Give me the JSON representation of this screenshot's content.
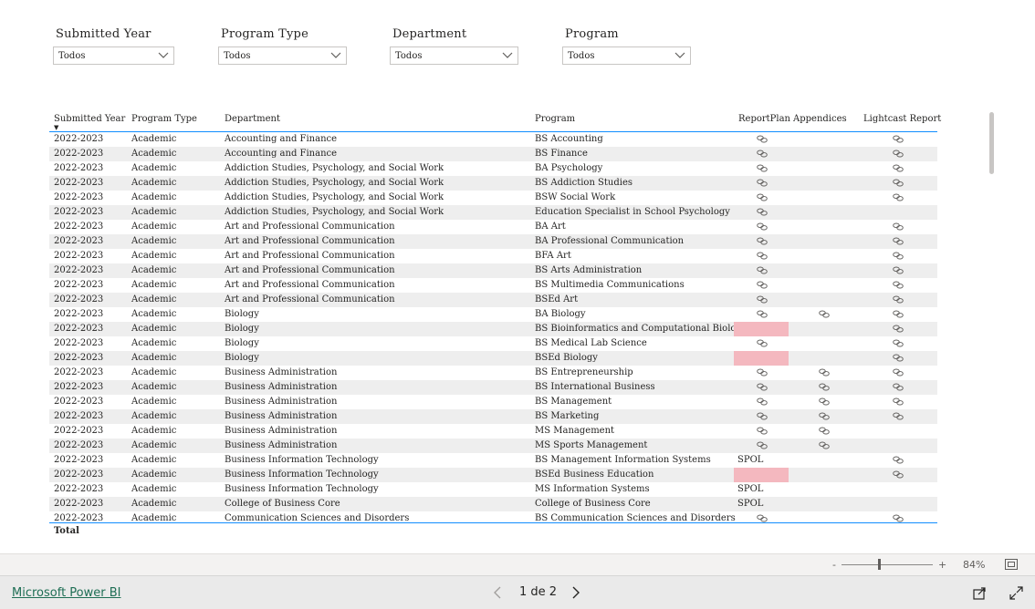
{
  "slicers": [
    {
      "title": "Submitted Year",
      "value": "Todos"
    },
    {
      "title": "Program Type",
      "value": "Todos"
    },
    {
      "title": "Department",
      "value": "Todos"
    },
    {
      "title": "Program",
      "value": "Todos"
    }
  ],
  "table": {
    "columns": [
      "Submitted Year",
      "Program Type",
      "Department",
      "Program",
      "ReportPlan",
      "Appendices",
      "Lightcast Report"
    ],
    "sort_indicator": "▼",
    "rows": [
      {
        "year": "2022-2023",
        "type": "Academic",
        "dept": "Accounting and Finance",
        "program": "BS Accounting",
        "rp": "link",
        "ap": "",
        "lc": "link"
      },
      {
        "year": "2022-2023",
        "type": "Academic",
        "dept": "Accounting and Finance",
        "program": "BS Finance",
        "rp": "link",
        "ap": "",
        "lc": "link"
      },
      {
        "year": "2022-2023",
        "type": "Academic",
        "dept": "Addiction Studies, Psychology, and Social Work",
        "program": "BA Psychology",
        "rp": "link",
        "ap": "",
        "lc": "link"
      },
      {
        "year": "2022-2023",
        "type": "Academic",
        "dept": "Addiction Studies, Psychology, and Social Work",
        "program": "BS Addiction Studies",
        "rp": "link",
        "ap": "",
        "lc": "link"
      },
      {
        "year": "2022-2023",
        "type": "Academic",
        "dept": "Addiction Studies, Psychology, and Social Work",
        "program": "BSW Social Work",
        "rp": "link",
        "ap": "",
        "lc": "link"
      },
      {
        "year": "2022-2023",
        "type": "Academic",
        "dept": "Addiction Studies, Psychology, and Social Work",
        "program": "Education Specialist in School Psychology",
        "rp": "link",
        "ap": "",
        "lc": ""
      },
      {
        "year": "2022-2023",
        "type": "Academic",
        "dept": "Art and Professional Communication",
        "program": "BA Art",
        "rp": "link",
        "ap": "",
        "lc": "link"
      },
      {
        "year": "2022-2023",
        "type": "Academic",
        "dept": "Art and Professional Communication",
        "program": "BA Professional Communication",
        "rp": "link",
        "ap": "",
        "lc": "link"
      },
      {
        "year": "2022-2023",
        "type": "Academic",
        "dept": "Art and Professional Communication",
        "program": "BFA Art",
        "rp": "link",
        "ap": "",
        "lc": "link"
      },
      {
        "year": "2022-2023",
        "type": "Academic",
        "dept": "Art and Professional Communication",
        "program": "BS Arts Administration",
        "rp": "link",
        "ap": "",
        "lc": "link"
      },
      {
        "year": "2022-2023",
        "type": "Academic",
        "dept": "Art and Professional Communication",
        "program": "BS Multimedia Communications",
        "rp": "link",
        "ap": "",
        "lc": "link"
      },
      {
        "year": "2022-2023",
        "type": "Academic",
        "dept": "Art and Professional Communication",
        "program": "BSEd Art",
        "rp": "link",
        "ap": "",
        "lc": "link"
      },
      {
        "year": "2022-2023",
        "type": "Academic",
        "dept": "Biology",
        "program": "BA Biology",
        "rp": "link",
        "ap": "link",
        "lc": "link"
      },
      {
        "year": "2022-2023",
        "type": "Academic",
        "dept": "Biology",
        "program": "BS Bioinformatics and Computational Biology",
        "rp": "pink",
        "ap": "",
        "lc": "link"
      },
      {
        "year": "2022-2023",
        "type": "Academic",
        "dept": "Biology",
        "program": "BS Medical Lab Science",
        "rp": "link",
        "ap": "",
        "lc": "link"
      },
      {
        "year": "2022-2023",
        "type": "Academic",
        "dept": "Biology",
        "program": "BSEd Biology",
        "rp": "pink",
        "ap": "",
        "lc": "link"
      },
      {
        "year": "2022-2023",
        "type": "Academic",
        "dept": "Business Administration",
        "program": "BS Entrepreneurship",
        "rp": "link",
        "ap": "link",
        "lc": "link"
      },
      {
        "year": "2022-2023",
        "type": "Academic",
        "dept": "Business Administration",
        "program": "BS International Business",
        "rp": "link",
        "ap": "link",
        "lc": "link"
      },
      {
        "year": "2022-2023",
        "type": "Academic",
        "dept": "Business Administration",
        "program": "BS Management",
        "rp": "link",
        "ap": "link",
        "lc": "link"
      },
      {
        "year": "2022-2023",
        "type": "Academic",
        "dept": "Business Administration",
        "program": "BS Marketing",
        "rp": "link",
        "ap": "link",
        "lc": "link"
      },
      {
        "year": "2022-2023",
        "type": "Academic",
        "dept": "Business Administration",
        "program": "MS Management",
        "rp": "link",
        "ap": "link",
        "lc": ""
      },
      {
        "year": "2022-2023",
        "type": "Academic",
        "dept": "Business Administration",
        "program": "MS Sports Management",
        "rp": "link",
        "ap": "link",
        "lc": ""
      },
      {
        "year": "2022-2023",
        "type": "Academic",
        "dept": "Business Information Technology",
        "program": "BS Management Information Systems",
        "rp": "SPOL",
        "ap": "",
        "lc": "link"
      },
      {
        "year": "2022-2023",
        "type": "Academic",
        "dept": "Business Information Technology",
        "program": "BSEd Business Education",
        "rp": "pink",
        "ap": "",
        "lc": "link"
      },
      {
        "year": "2022-2023",
        "type": "Academic",
        "dept": "Business Information Technology",
        "program": "MS Information Systems",
        "rp": "SPOL",
        "ap": "",
        "lc": ""
      },
      {
        "year": "2022-2023",
        "type": "Academic",
        "dept": "College of Business Core",
        "program": "College of Business Core",
        "rp": "SPOL",
        "ap": "",
        "lc": ""
      },
      {
        "year": "2022-2023",
        "type": "Academic",
        "dept": "Communication Sciences and Disorders",
        "program": "BS Communication Sciences and Disorders",
        "rp": "link",
        "ap": "",
        "lc": "link"
      }
    ],
    "total_label": "Total"
  },
  "zoom": {
    "minus": "-",
    "plus": "+",
    "level": "84%",
    "level_fraction": 0.84
  },
  "footer": {
    "brand": "Microsoft Power BI",
    "page_indicator": "1 de 2"
  },
  "colors": {
    "accent": "#118dff",
    "highlight": "#f4b8bf",
    "link_icon": "#605e5c",
    "brand": "#1e6e54"
  }
}
